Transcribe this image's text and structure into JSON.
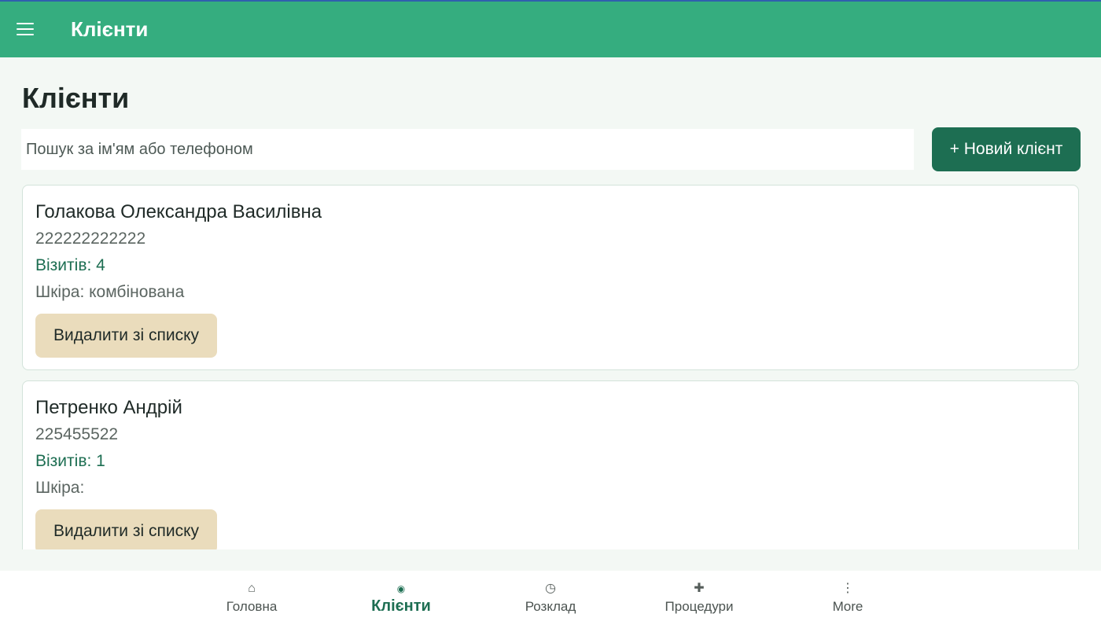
{
  "appbar": {
    "title": "Клієнти"
  },
  "page": {
    "title": "Клієнти"
  },
  "search": {
    "placeholder": "Пошук за ім'ям або телефоном",
    "value": ""
  },
  "actions": {
    "new_client_label": "+ Новий клієнт"
  },
  "clients": [
    {
      "name": "Голакова Олександра Василівна",
      "phone": "222222222222",
      "visits": "Візитів: 4",
      "skin": "Шкіра: комбінована",
      "delete_label": "Видалити зі списку"
    },
    {
      "name": "Петренко Андрій",
      "phone": "225455522",
      "visits": "Візитів: 1",
      "skin": "Шкіра:",
      "delete_label": "Видалити зі списку"
    }
  ],
  "nav": {
    "items": [
      {
        "label": "Головна",
        "icon": "home-icon",
        "glyph": "⌂"
      },
      {
        "label": "Клієнти",
        "icon": "clients-icon",
        "glyph": "◉"
      },
      {
        "label": "Розклад",
        "icon": "clock-icon",
        "glyph": "◷"
      },
      {
        "label": "Процедури",
        "icon": "plus-icon",
        "glyph": "✚"
      },
      {
        "label": "More",
        "icon": "more-icon",
        "glyph": "⋮"
      }
    ],
    "active": "Клієнти"
  },
  "colors": {
    "appbar": "#35ad7f",
    "primary": "#1d6e52",
    "delete_button": "#eadcbc",
    "background": "#f3f8f4"
  }
}
